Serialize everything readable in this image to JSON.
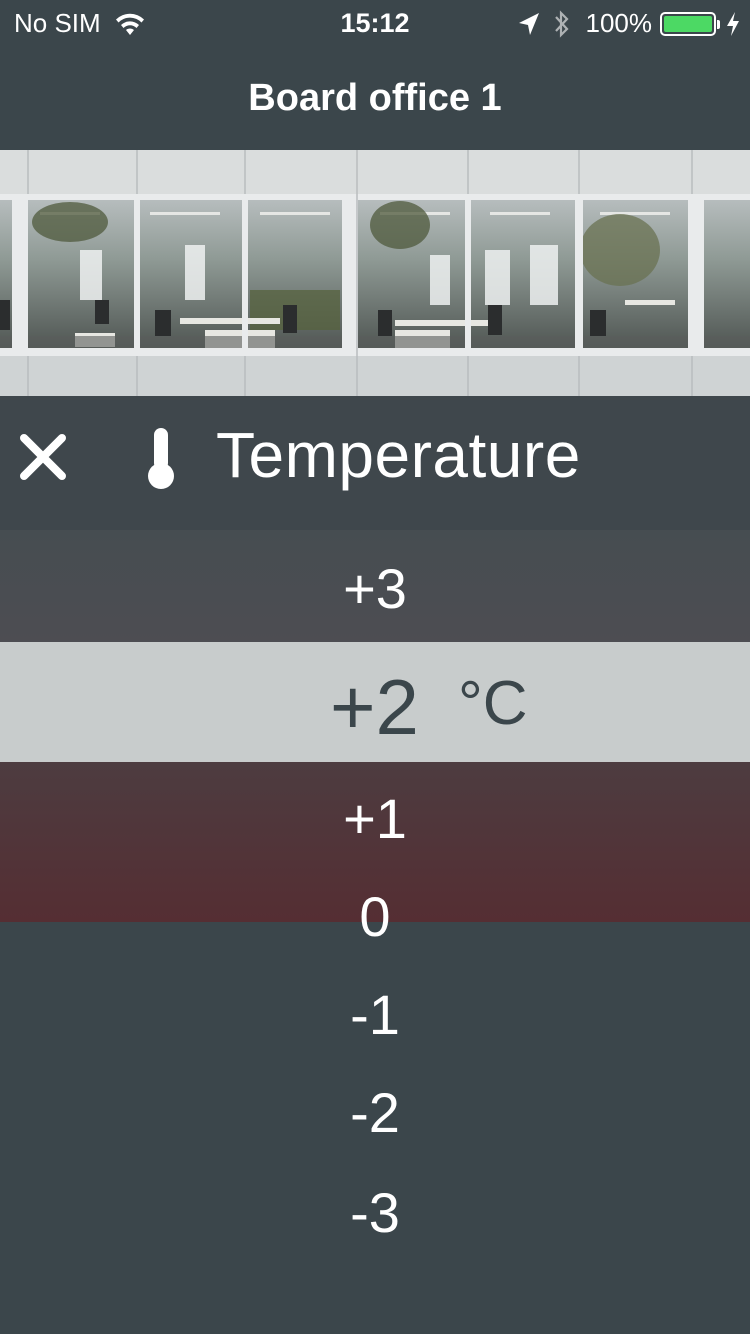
{
  "status_bar": {
    "carrier": "No SIM",
    "time": "15:12",
    "battery_percent": "100%",
    "battery_level": 1.0,
    "icons": [
      "wifi-icon",
      "location-arrow-icon",
      "bluetooth-icon",
      "battery-icon",
      "charging-bolt-icon"
    ]
  },
  "nav": {
    "title": "Board office 1"
  },
  "hero_image": {
    "subject": "office building glass facade"
  },
  "panel": {
    "title": "Temperature",
    "close_icon": "close-icon",
    "title_icon": "thermometer-icon"
  },
  "picker": {
    "options": [
      "+3",
      "+2",
      "+1",
      "0",
      "-1",
      "-2",
      "-3"
    ],
    "selected_value": "+2",
    "unit": "°C"
  },
  "colors": {
    "background": "#3b464b",
    "selected_band": "#c8cccc",
    "heating_band": "#552e33",
    "battery_green": "#4cd964"
  }
}
